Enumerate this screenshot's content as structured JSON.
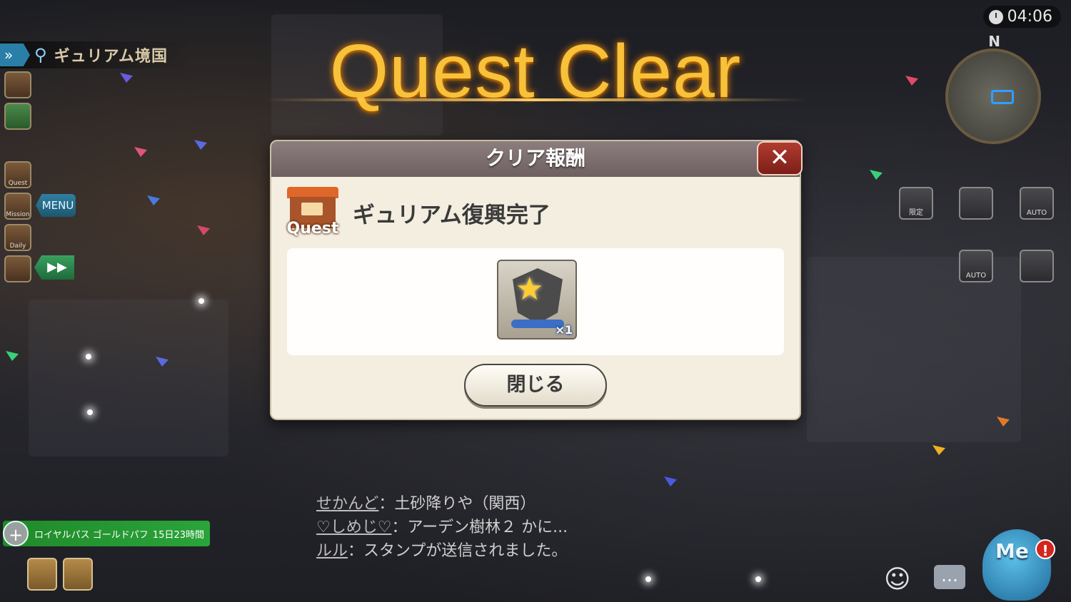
{
  "hud": {
    "clock": "04:06",
    "location": "ギュリアム境国",
    "compass": "N",
    "menu_label": "MENU",
    "skip_label": "▶▶",
    "left_icons": [
      "Quest",
      "Mission",
      "Daily"
    ]
  },
  "banner": {
    "title": "Quest Clear"
  },
  "dialog": {
    "title": "クリア報酬",
    "close_icon": "✕",
    "quest_icon_label": "Quest",
    "quest_name": "ギュリアム復興完了",
    "reward": {
      "icon": "gold-star-emblem",
      "quantity": "×1"
    },
    "close_button": "閉じる"
  },
  "right_icons": {
    "limited": "限定",
    "auto1": "AUTO",
    "auto2": "AUTO"
  },
  "chat": [
    {
      "name": "せかんど",
      "msg": "：土砂降りや（関西）"
    },
    {
      "name": "♡しめじ♡",
      "msg": "：アーデン樹林２ かに..."
    },
    {
      "name": "ルル",
      "msg": "：スタンプが送信されました。"
    }
  ],
  "pass": {
    "name": "ロイヤルパス ゴールドパフ",
    "time": "15日23時間"
  },
  "me_button": {
    "label": "Me",
    "alert": "!"
  }
}
